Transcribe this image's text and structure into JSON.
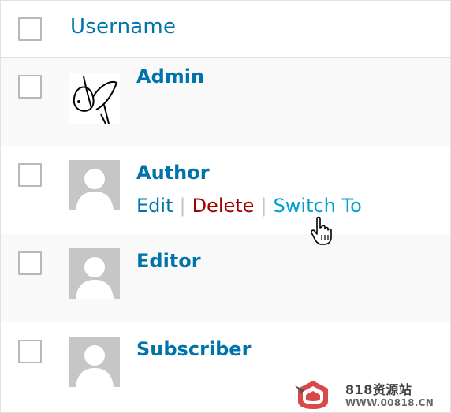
{
  "table": {
    "column_header": "Username",
    "rows": [
      {
        "username": "Admin",
        "avatar": "custom-drawing-avatar",
        "alt": true
      },
      {
        "username": "Author",
        "avatar": "default-avatar",
        "alt": false,
        "actions": {
          "edit": "Edit",
          "delete": "Delete",
          "switch_to": "Switch To"
        }
      },
      {
        "username": "Editor",
        "avatar": "default-avatar",
        "alt": true
      },
      {
        "username": "Subscriber",
        "avatar": "default-avatar",
        "alt": false
      }
    ]
  },
  "watermark": {
    "title": "818资源站",
    "url": "WWW.00818.CN"
  },
  "colors": {
    "link": "#0073aa",
    "delete": "#a00000",
    "switch": "#00a0d2",
    "avatar_bg": "#c6c6c6"
  }
}
